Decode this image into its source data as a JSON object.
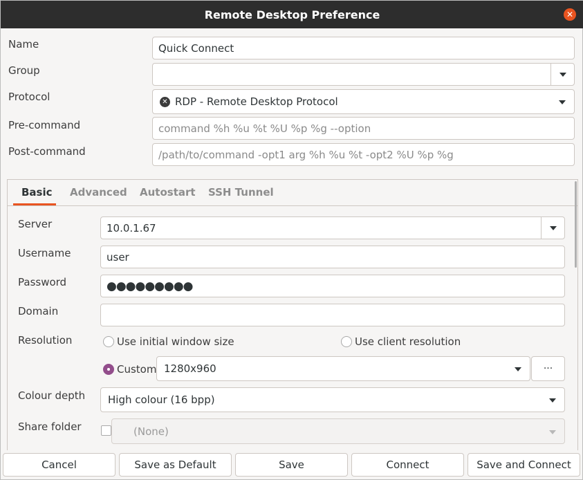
{
  "window": {
    "title": "Remote Desktop Preference"
  },
  "profile": {
    "name_label": "Name",
    "name_value": "Quick Connect",
    "group_label": "Group",
    "group_value": "",
    "protocol_label": "Protocol",
    "protocol_value": "RDP - Remote Desktop Protocol",
    "protocol_icon": "rdp-protocol-icon",
    "precommand_label": "Pre-command",
    "precommand_placeholder": "command %h %u %t %U %p %g --option",
    "postcommand_label": "Post-command",
    "postcommand_placeholder": "/path/to/command -opt1 arg %h %u %t -opt2 %U %p %g"
  },
  "tabs": [
    {
      "label": "Basic",
      "active": true
    },
    {
      "label": "Advanced",
      "active": false
    },
    {
      "label": "Autostart",
      "active": false
    },
    {
      "label": "SSH Tunnel",
      "active": false
    }
  ],
  "basic": {
    "server_label": "Server",
    "server_value": "10.0.1.67",
    "username_label": "Username",
    "username_value": "user",
    "password_label": "Password",
    "password_value": "●●●●●●●●●",
    "domain_label": "Domain",
    "domain_value": "",
    "resolution_label": "Resolution",
    "resolution_options": {
      "initial": "Use initial window size",
      "client": "Use client resolution",
      "custom": "Custom"
    },
    "resolution_selected": "custom",
    "custom_resolution": "1280x960",
    "resolution_more": "···",
    "colour_depth_label": "Colour depth",
    "colour_depth_value": "High colour (16 bpp)",
    "share_folder_label": "Share folder",
    "share_folder_checked": false,
    "share_folder_value": "(None)"
  },
  "footer": {
    "cancel": "Cancel",
    "save_default": "Save as Default",
    "save": "Save",
    "connect": "Connect",
    "save_connect": "Save and Connect"
  },
  "colors": {
    "accent": "#e95420",
    "radio_checked": "#924d8b",
    "titlebar": "#2d2d2d"
  }
}
